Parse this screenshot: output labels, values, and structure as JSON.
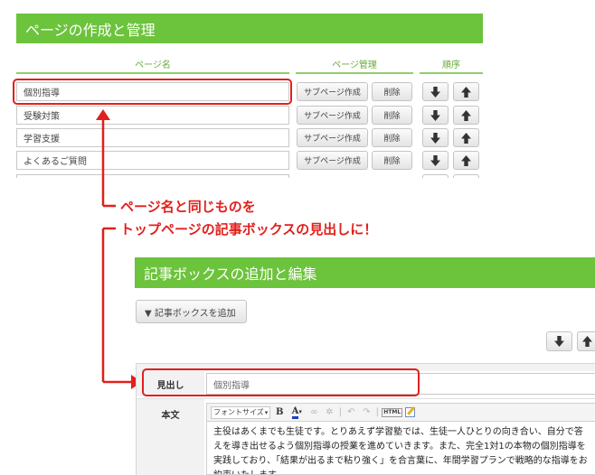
{
  "page_management": {
    "title": "ページの作成と管理",
    "columns": {
      "name": "ページ名",
      "manage": "ページ管理",
      "order": "順序"
    },
    "subpage_label": "サブページ作成",
    "delete_label": "削除",
    "pages": [
      "個別指導",
      "受験対策",
      "学習支援",
      "よくあるご質問"
    ]
  },
  "annotation": {
    "line1": "ページ名と同じものを",
    "line2": "トップページの記事ボックスの見出しに！"
  },
  "article_box": {
    "title": "記事ボックスの追加と編集",
    "add_label": "▼ 記事ボックスを追加",
    "heading_label": "見出し",
    "heading_value": "個別指導",
    "body_label": "本文",
    "toolbar": {
      "font_size": "フォントサイズ",
      "bold": "B",
      "color": "A",
      "html": "HTML"
    },
    "body_text": "主役はあくまでも生徒です。とりあえず学習塾では、生徒一人ひとりの向き合い、自分で答えを導き出せるよう個別指導の授業を進めていきます。また、完全1対1の本物の個別指導を実践しており、「結果が出るまで粘り強く」を合言葉に、年間学習プランで戦略的な指導をお約束いたします。"
  },
  "colors": {
    "accent_green": "#6cc33c",
    "highlight_red": "#e0201c"
  }
}
